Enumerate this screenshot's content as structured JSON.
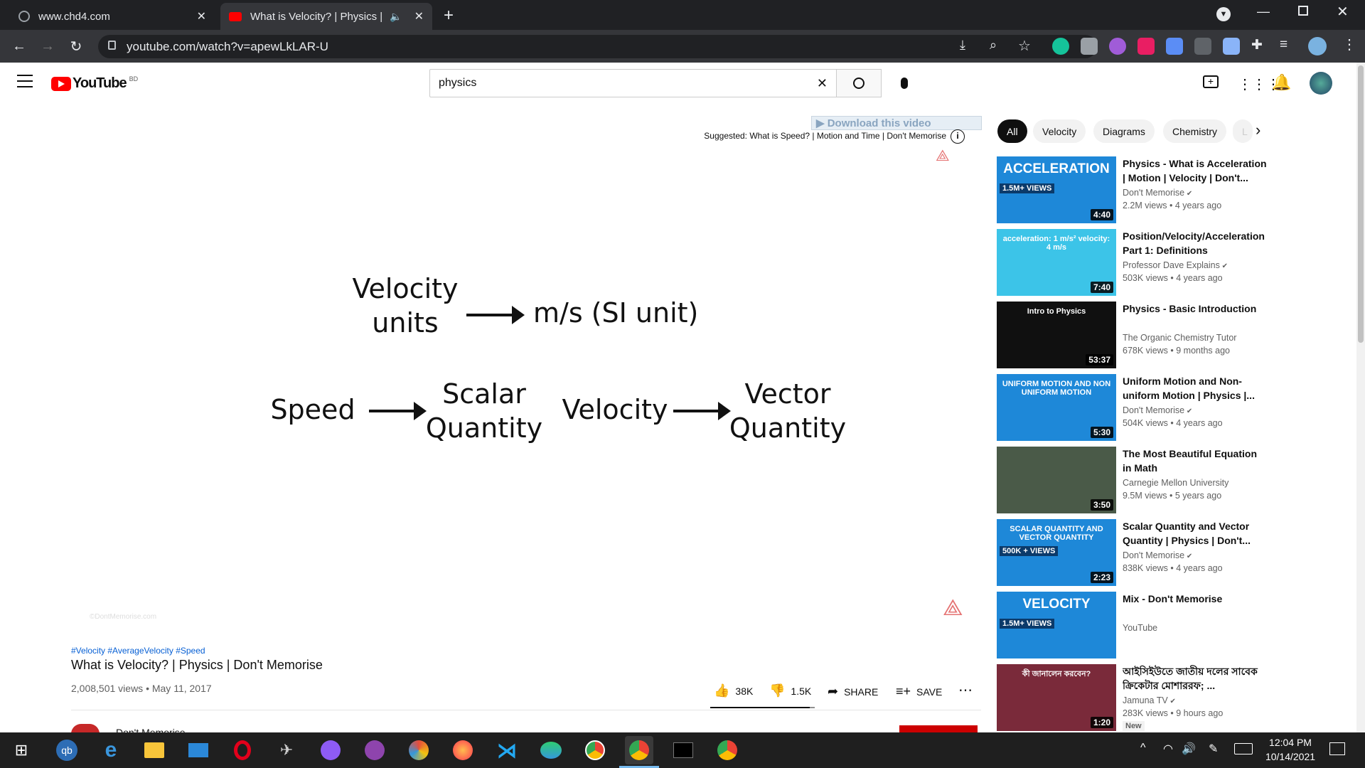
{
  "browser": {
    "tabs": [
      {
        "title": "www.chd4.com"
      },
      {
        "title": "What is Velocity? | Physics | D"
      }
    ],
    "url": "youtube.com/watch?v=apewLkLAR-U"
  },
  "youtube": {
    "logo": "YouTube",
    "region": "BD",
    "search_value": "physics"
  },
  "video": {
    "overlay_download": "Download this video",
    "overlay_suggested": "Suggested: What is Speed? | Motion and Time | Don't Memorise",
    "watermark": "©DontMemorise.com",
    "content": {
      "line1_left_a": "Velocity",
      "line1_left_b": "units",
      "line1_right": "m/s  (SI unit)",
      "speed": "Speed",
      "scalar_a": "Scalar",
      "scalar_b": "Quantity",
      "velocity": "Velocity",
      "vector_a": "Vector",
      "vector_b": "Quantity"
    },
    "hashtags": "#Velocity #AverageVelocity #Speed",
    "title": "What is Velocity? | Physics | Don't Memorise",
    "views_date": "2,008,501 views • May 11, 2017",
    "likes": "38K",
    "dislikes": "1.5K",
    "share": "SHARE",
    "save": "SAVE",
    "channel_partial": "Don't Memorise"
  },
  "chips": [
    "All",
    "Velocity",
    "Diagrams",
    "Chemistry",
    "L"
  ],
  "recommendations": [
    {
      "title": "Physics - What is Acceleration | Motion | Velocity | Don't...",
      "channel": "Don't Memorise",
      "verified": true,
      "meta": "2.2M views • 4 years ago",
      "duration": "4:40",
      "thumb_text": "ACCELERATION",
      "thumb_badge": "1.5M+ VIEWS",
      "color": "#1e88d8"
    },
    {
      "title": "Position/Velocity/Acceleration Part 1: Definitions",
      "channel": "Professor Dave Explains",
      "verified": true,
      "meta": "503K views • 4 years ago",
      "duration": "7:40",
      "thumb_text": "acceleration: 1 m/s²   velocity: 4 m/s",
      "thumb_badge": "",
      "color": "#3cc4e8"
    },
    {
      "title": "Physics - Basic Introduction",
      "channel": "The Organic Chemistry Tutor",
      "verified": false,
      "meta": "678K views • 9 months ago",
      "duration": "53:37",
      "thumb_text": "Intro to Physics",
      "thumb_badge": "",
      "color": "#101010"
    },
    {
      "title": "Uniform Motion and Non-uniform Motion | Physics |...",
      "channel": "Don't Memorise",
      "verified": true,
      "meta": "504K views • 4 years ago",
      "duration": "5:30",
      "thumb_text": "UNIFORM MOTION AND NON UNIFORM MOTION",
      "thumb_badge": "",
      "color": "#1e88d8"
    },
    {
      "title": "The Most Beautiful Equation in Math",
      "channel": "Carnegie Mellon University",
      "verified": false,
      "meta": "9.5M views • 5 years ago",
      "duration": "3:50",
      "thumb_text": "",
      "thumb_badge": "",
      "color": "#4a5a48"
    },
    {
      "title": "Scalar Quantity and Vector Quantity | Physics | Don't...",
      "channel": "Don't Memorise",
      "verified": true,
      "meta": "838K views • 4 years ago",
      "duration": "2:23",
      "thumb_text": "SCALAR QUANTITY AND VECTOR QUANTITY",
      "thumb_badge": "500K + VIEWS",
      "color": "#1e88d8"
    },
    {
      "title": "Mix - Don't Memorise",
      "channel": "YouTube",
      "verified": false,
      "meta": "",
      "duration": "",
      "thumb_text": "VELOCITY",
      "thumb_badge": "1.5M+ VIEWS",
      "color": "#1e88d8"
    },
    {
      "title": "আইসিইউতে জাতীয় দলের সাবেক ক্রিকেটার মোশাররফ; ...",
      "channel": "Jamuna TV",
      "verified": true,
      "meta": "283K views • 9 hours ago",
      "duration": "1:20",
      "thumb_text": "কী জানালেন করবেন?",
      "thumb_badge": "New",
      "color": "#7a2a3a"
    }
  ],
  "taskbar": {
    "time": "12:04 PM",
    "date": "10/14/2021"
  }
}
